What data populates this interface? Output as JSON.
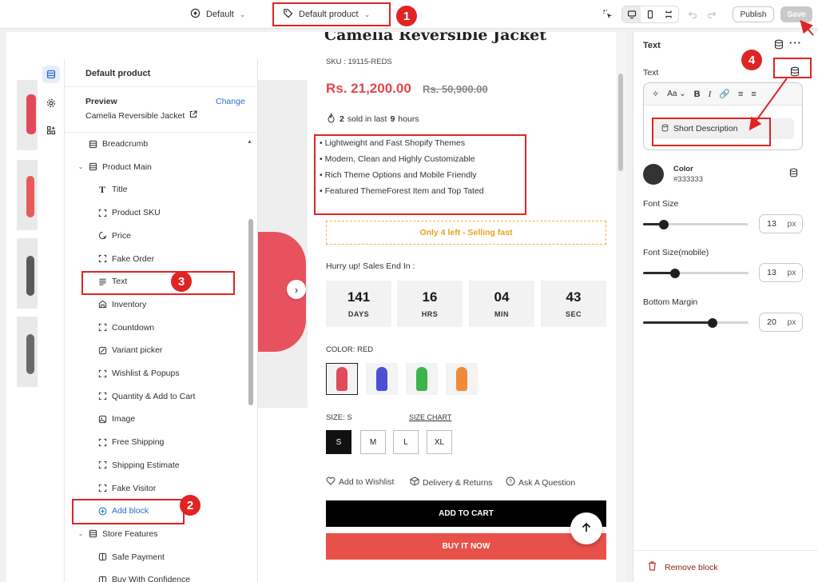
{
  "topbar": {
    "theme_label": "Default",
    "template_label": "Default product",
    "publish_label": "Publish",
    "save_label": "Save"
  },
  "annotations": [
    "1",
    "2",
    "3",
    "4"
  ],
  "sidebar": {
    "title": "Default product",
    "preview_label": "Preview",
    "change_label": "Change",
    "preview_product": "Camelia Reversible Jacket",
    "items": [
      {
        "label": "Breadcrumb",
        "icon": "section-icon"
      },
      {
        "label": "Product Main",
        "icon": "section-icon"
      },
      {
        "label": "Title",
        "icon": "title-icon"
      },
      {
        "label": "Product SKU",
        "icon": "block-icon"
      },
      {
        "label": "Price",
        "icon": "price-icon"
      },
      {
        "label": "Fake Order",
        "icon": "block-icon"
      },
      {
        "label": "Text",
        "icon": "text-icon"
      },
      {
        "label": "Inventory",
        "icon": "inventory-icon"
      },
      {
        "label": "Countdown",
        "icon": "block-icon"
      },
      {
        "label": "Variant picker",
        "icon": "variant-icon"
      },
      {
        "label": "Wishlist & Popups",
        "icon": "block-icon"
      },
      {
        "label": "Quantity & Add to Cart",
        "icon": "block-icon"
      },
      {
        "label": "Image",
        "icon": "image-icon"
      },
      {
        "label": "Free Shipping",
        "icon": "block-icon"
      },
      {
        "label": "Shipping Estimate",
        "icon": "block-icon"
      },
      {
        "label": "Fake Visitor",
        "icon": "block-icon"
      },
      {
        "label": "Add block",
        "icon": "plus-icon"
      },
      {
        "label": "Store Features",
        "icon": "section-icon"
      },
      {
        "label": "Safe Payment",
        "icon": "book-icon"
      },
      {
        "label": "Buy With Confidence",
        "icon": "book-icon"
      }
    ]
  },
  "product": {
    "title": "Camelia Reversible Jacket",
    "sku": "SKU : 19115-REDS",
    "price": "Rs. 21,200.00",
    "compare_price": "Rs. 50,900.00",
    "sold_prefix": "2",
    "sold_mid": "sold in last",
    "sold_hours": "9",
    "sold_suffix": "hours",
    "bullets": [
      "Lightweight and Fast Shopify Themes",
      "Modern, Clean and Highly Customizable",
      "Rich Theme Options and Mobile Friendly",
      "Featured ThemeForest Item and Top Tated"
    ],
    "stock_notice": "Only 4 left - Selling fast",
    "hurry_label": "Hurry up! Sales End In :",
    "countdown": [
      {
        "value": "141",
        "unit": "DAYS"
      },
      {
        "value": "16",
        "unit": "HRS"
      },
      {
        "value": "04",
        "unit": "MIN"
      },
      {
        "value": "43",
        "unit": "SEC"
      }
    ],
    "color_label": "COLOR:",
    "color_value": "RED",
    "swatch_colors": [
      "#e04a5a",
      "#4a4fd6",
      "#3bb54a",
      "#f08a3a"
    ],
    "size_label": "SIZE:",
    "size_value": "S",
    "size_chart": "SIZE CHART",
    "sizes": [
      "S",
      "M",
      "L",
      "XL"
    ],
    "wishlist": "Add to Wishlist",
    "delivery": "Delivery & Returns",
    "question": "Ask A Question",
    "add_to_cart": "ADD TO CART",
    "buy_now": "BUY IT NOW"
  },
  "rightpanel": {
    "title": "Text",
    "text_label": "Text",
    "dynamic_source": "Short Description",
    "color_label": "Color",
    "color_value": "#333333",
    "font_size_label": "Font Size",
    "font_size_value": "13",
    "font_size_fraction": 0.2,
    "font_size_mobile_label": "Font Size(mobile)",
    "font_size_mobile_value": "13",
    "font_size_mobile_fraction": 0.3,
    "bottom_margin_label": "Bottom Margin",
    "bottom_margin_value": "20",
    "bottom_margin_fraction": 0.66,
    "unit": "px",
    "remove_label": "Remove block"
  },
  "colors": {
    "accent": "#2c6ecb",
    "price": "#e0474c",
    "buy_now": "#e8514a",
    "annotation": "#e02424",
    "swatch_color": "#333333"
  }
}
